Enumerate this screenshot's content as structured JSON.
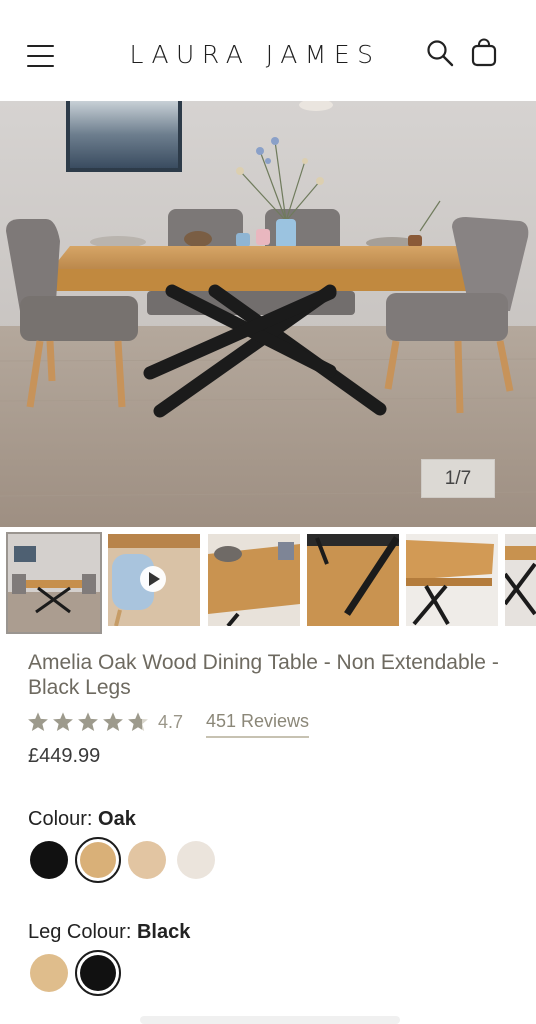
{
  "header": {
    "brand": "LAURA JAMES",
    "icons": [
      "menu-icon",
      "search-icon",
      "cart-icon"
    ]
  },
  "gallery": {
    "counter": "1/7",
    "thumbnails": [
      "thumb-dining-room",
      "thumb-chair-video",
      "thumb-tabletop-detail",
      "thumb-leg-detail",
      "thumb-corner-detail",
      "thumb-leg-closeup"
    ]
  },
  "product": {
    "title": "Amelia Oak Wood Dining Table - Non Extendable - Black Legs",
    "rating": 4.7,
    "rating_text": "4.7",
    "reviews": "451 Reviews",
    "price": "£449.99"
  },
  "options": {
    "colour": {
      "label": "Colour:",
      "value": "Oak",
      "swatches": [
        {
          "name": "black",
          "color": "#111111"
        },
        {
          "name": "oak",
          "color": "#d9b078",
          "selected": true
        },
        {
          "name": "light-oak",
          "color": "#e2c5a2"
        },
        {
          "name": "white-wash",
          "color": "#ebe4dc"
        }
      ]
    },
    "leg_colour": {
      "label": "Leg Colour:",
      "value": "Black",
      "swatches": [
        {
          "name": "oak",
          "color": "#dfbd8c"
        },
        {
          "name": "black",
          "color": "#111111",
          "selected": true
        }
      ]
    }
  },
  "colors": {
    "title_text": "#6e6a60",
    "star": "#9d9a8c",
    "wood": "#c9934f",
    "leg": "#1b1b1b"
  }
}
